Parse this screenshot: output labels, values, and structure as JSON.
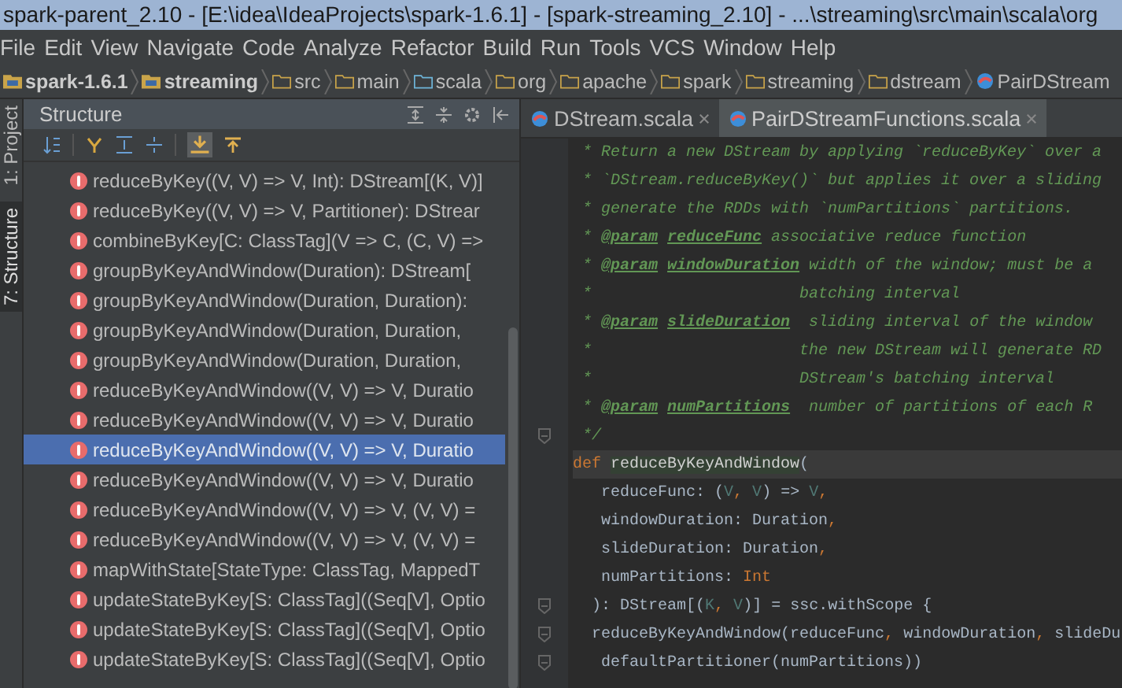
{
  "window": {
    "title": "spark-parent_2.10 - [E:\\idea\\IdeaProjects\\spark-1.6.1] - [spark-streaming_2.10] - ...\\streaming\\src\\main\\scala\\org"
  },
  "menu": [
    "File",
    "Edit",
    "View",
    "Navigate",
    "Code",
    "Analyze",
    "Refactor",
    "Build",
    "Run",
    "Tools",
    "VCS",
    "Window",
    "Help"
  ],
  "breadcrumb": [
    {
      "label": "spark-1.6.1",
      "kind": "module"
    },
    {
      "label": "streaming",
      "kind": "module"
    },
    {
      "label": "src",
      "kind": "folder"
    },
    {
      "label": "main",
      "kind": "folder"
    },
    {
      "label": "scala",
      "kind": "source"
    },
    {
      "label": "org",
      "kind": "folder"
    },
    {
      "label": "apache",
      "kind": "folder"
    },
    {
      "label": "spark",
      "kind": "folder"
    },
    {
      "label": "streaming",
      "kind": "folder"
    },
    {
      "label": "dstream",
      "kind": "folder"
    },
    {
      "label": "PairDStream",
      "kind": "class"
    }
  ],
  "side_tabs": [
    {
      "label": "1: Project",
      "selected": false
    },
    {
      "label": "7: Structure",
      "selected": true
    }
  ],
  "structure": {
    "title": "Structure",
    "items": [
      {
        "text": "reduceByKey((V, V) => V, Int): DStream[(K, V)]",
        "selected": false
      },
      {
        "text": "reduceByKey((V, V) => V, Partitioner): DStrear",
        "selected": false
      },
      {
        "text": "combineByKey[C: ClassTag](V => C, (C, V) =>",
        "selected": false
      },
      {
        "text": "groupByKeyAndWindow(Duration): DStream[",
        "selected": false
      },
      {
        "text": "groupByKeyAndWindow(Duration, Duration):",
        "selected": false
      },
      {
        "text": "groupByKeyAndWindow(Duration, Duration,",
        "selected": false
      },
      {
        "text": "groupByKeyAndWindow(Duration, Duration,",
        "selected": false
      },
      {
        "text": "reduceByKeyAndWindow((V, V) => V, Duratio",
        "selected": false
      },
      {
        "text": "reduceByKeyAndWindow((V, V) => V, Duratio",
        "selected": false
      },
      {
        "text": "reduceByKeyAndWindow((V, V) => V, Duratio",
        "selected": true
      },
      {
        "text": "reduceByKeyAndWindow((V, V) => V, Duratio",
        "selected": false
      },
      {
        "text": "reduceByKeyAndWindow((V, V) => V, (V, V) =",
        "selected": false
      },
      {
        "text": "reduceByKeyAndWindow((V, V) => V, (V, V) =",
        "selected": false
      },
      {
        "text": "mapWithState[StateType: ClassTag, MappedT",
        "selected": false
      },
      {
        "text": "updateStateByKey[S: ClassTag]((Seq[V], Optio",
        "selected": false
      },
      {
        "text": "updateStateByKey[S: ClassTag]((Seq[V], Optio",
        "selected": false
      },
      {
        "text": "updateStateByKey[S: ClassTag]((Seq[V], Optio",
        "selected": false
      }
    ]
  },
  "editor_tabs": [
    {
      "label": "DStream.scala",
      "selected": false
    },
    {
      "label": "PairDStreamFunctions.scala",
      "selected": true
    }
  ],
  "code": [
    {
      "fold": false,
      "current": false,
      "segments": [
        {
          "kind": "comment",
          "text": " * Return a new DStream by applying `reduceByKey` over a"
        }
      ]
    },
    {
      "fold": false,
      "current": false,
      "segments": [
        {
          "kind": "comment",
          "text": " * `DStream.reduceByKey()` but applies it over a sliding"
        }
      ]
    },
    {
      "fold": false,
      "current": false,
      "segments": [
        {
          "kind": "comment",
          "text": " * generate the RDDs with `numPartitions` partitions."
        }
      ]
    },
    {
      "fold": false,
      "current": false,
      "segments": [
        {
          "kind": "comment",
          "text": " * "
        },
        {
          "kind": "doctag",
          "text": "@param"
        },
        {
          "kind": "doctag",
          "text": "reduceFunc"
        },
        {
          "kind": "comment",
          "text": " associative reduce function"
        }
      ]
    },
    {
      "fold": false,
      "current": false,
      "segments": [
        {
          "kind": "comment",
          "text": " * "
        },
        {
          "kind": "doctag",
          "text": "@param"
        },
        {
          "kind": "doctag",
          "text": "windowDuration"
        },
        {
          "kind": "comment",
          "text": " width of the window; must be a"
        }
      ]
    },
    {
      "fold": false,
      "current": false,
      "segments": [
        {
          "kind": "comment",
          "text": " *                      batching interval"
        }
      ]
    },
    {
      "fold": false,
      "current": false,
      "segments": [
        {
          "kind": "comment",
          "text": " * "
        },
        {
          "kind": "doctag",
          "text": "@param"
        },
        {
          "kind": "doctag",
          "text": "slideDuration"
        },
        {
          "kind": "comment",
          "text": "  sliding interval of the window"
        }
      ]
    },
    {
      "fold": false,
      "current": false,
      "segments": [
        {
          "kind": "comment",
          "text": " *                      the new DStream will generate RD"
        }
      ]
    },
    {
      "fold": false,
      "current": false,
      "segments": [
        {
          "kind": "comment",
          "text": " *                      DStream's batching interval"
        }
      ]
    },
    {
      "fold": false,
      "current": false,
      "segments": [
        {
          "kind": "comment",
          "text": " * "
        },
        {
          "kind": "doctag",
          "text": "@param"
        },
        {
          "kind": "doctag",
          "text": "numPartitions"
        },
        {
          "kind": "comment",
          "text": "  number of partitions of each R"
        }
      ]
    },
    {
      "fold": true,
      "current": false,
      "segments": [
        {
          "kind": "comment",
          "text": " */"
        }
      ]
    },
    {
      "fold": false,
      "current": true,
      "segments": [
        {
          "kind": "keyword",
          "text": "def "
        },
        {
          "kind": "highlight",
          "text": "reduceByKeyAndWindow"
        },
        {
          "kind": "plain",
          "text": "("
        }
      ]
    },
    {
      "fold": false,
      "current": false,
      "segments": [
        {
          "kind": "plain",
          "text": "   reduceFunc: ("
        },
        {
          "kind": "typeparam",
          "text": "V"
        },
        {
          "kind": "keyword",
          "text": ", "
        },
        {
          "kind": "typeparam",
          "text": "V"
        },
        {
          "kind": "plain",
          "text": ") => "
        },
        {
          "kind": "typeparam",
          "text": "V"
        },
        {
          "kind": "keyword",
          "text": ","
        }
      ]
    },
    {
      "fold": false,
      "current": false,
      "segments": [
        {
          "kind": "plain",
          "text": "   windowDuration: Duration"
        },
        {
          "kind": "keyword",
          "text": ","
        }
      ]
    },
    {
      "fold": false,
      "current": false,
      "segments": [
        {
          "kind": "plain",
          "text": "   slideDuration: Duration"
        },
        {
          "kind": "keyword",
          "text": ","
        }
      ]
    },
    {
      "fold": false,
      "current": false,
      "segments": [
        {
          "kind": "plain",
          "text": "   numPartitions: "
        },
        {
          "kind": "keyword",
          "text": "Int"
        }
      ]
    },
    {
      "fold": true,
      "current": false,
      "segments": [
        {
          "kind": "plain",
          "text": "  ): DStream[("
        },
        {
          "kind": "typeparam",
          "text": "K"
        },
        {
          "kind": "keyword",
          "text": ", "
        },
        {
          "kind": "typeparam",
          "text": "V"
        },
        {
          "kind": "plain",
          "text": ")] = ssc.withScope {"
        }
      ]
    },
    {
      "fold": true,
      "current": false,
      "segments": [
        {
          "kind": "plain",
          "text": "  reduceByKeyAndWindow(reduceFunc"
        },
        {
          "kind": "keyword",
          "text": ", "
        },
        {
          "kind": "plain",
          "text": "windowDuration"
        },
        {
          "kind": "keyword",
          "text": ", "
        },
        {
          "kind": "plain",
          "text": "slideDu"
        }
      ]
    },
    {
      "fold": true,
      "current": false,
      "segments": [
        {
          "kind": "plain",
          "text": "   defaultPartitioner(numPartitions))"
        }
      ]
    }
  ]
}
